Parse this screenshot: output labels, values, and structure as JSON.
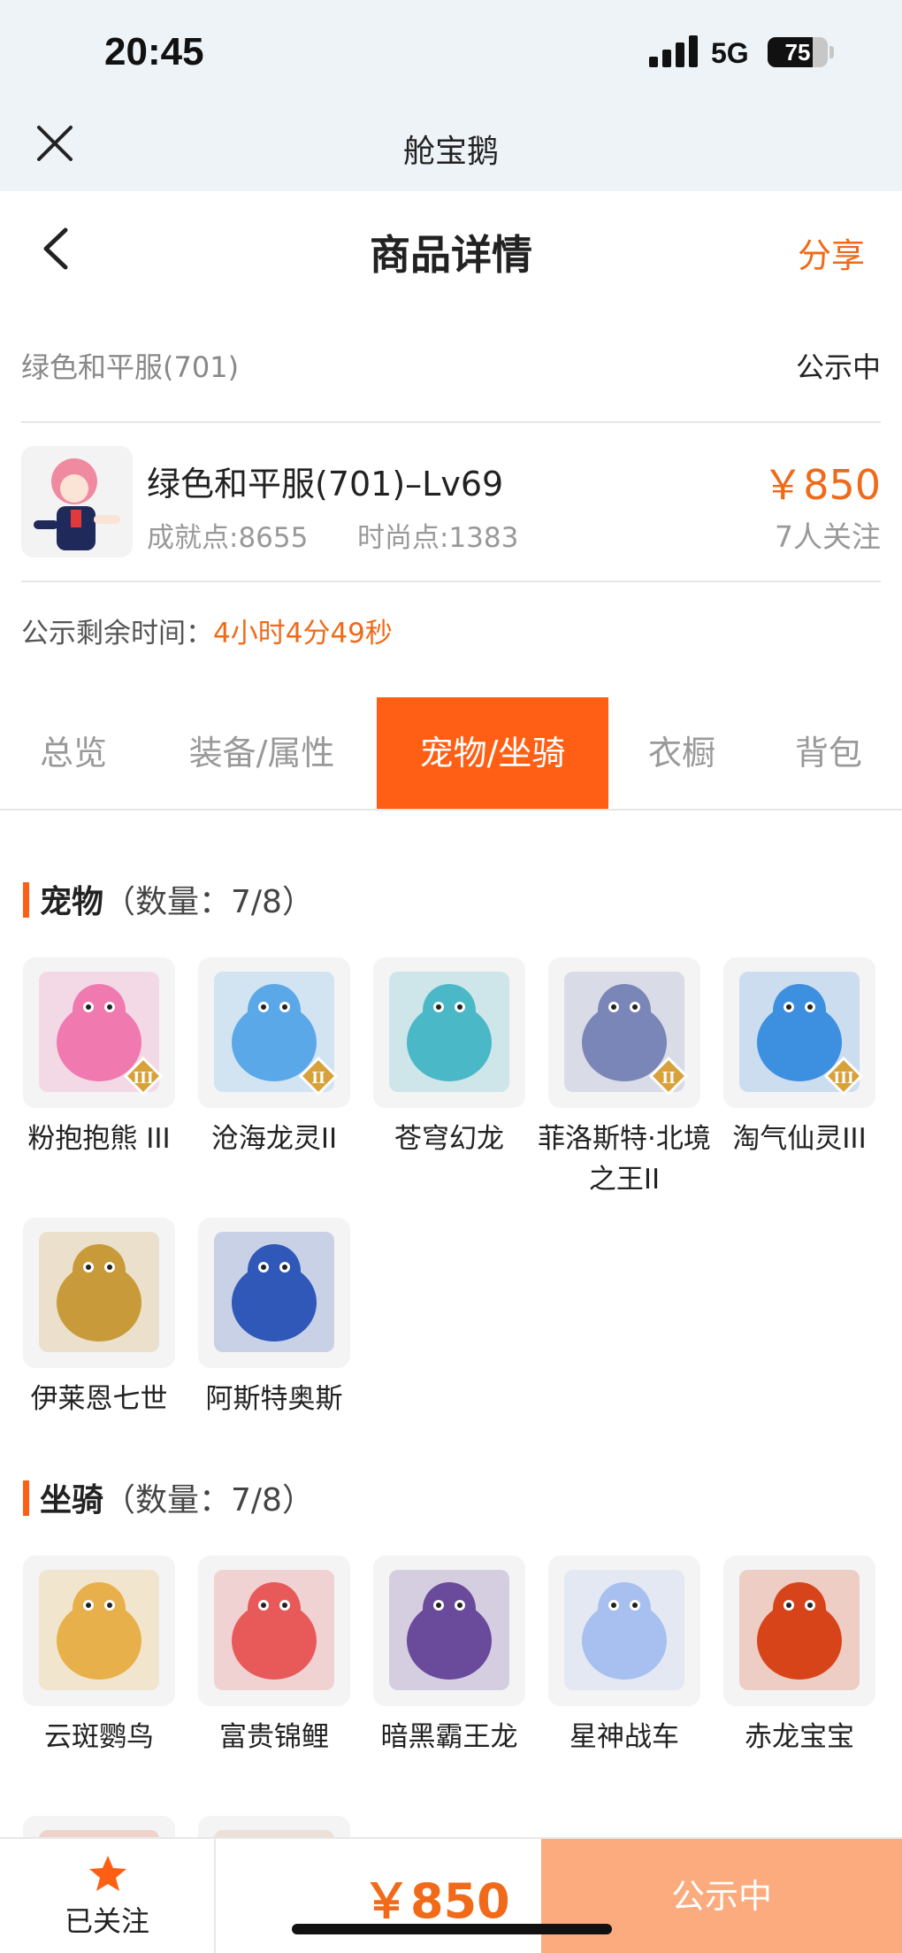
{
  "status": {
    "time": "20:45",
    "network": "5G",
    "battery": "75",
    "battery_level": 0.75
  },
  "app": {
    "title": "舱宝鹅"
  },
  "nav": {
    "title": "商品详情",
    "share": "分享"
  },
  "listing": {
    "name": "绿色和平服(701)",
    "state": "公示中"
  },
  "product": {
    "title": "绿色和平服(701)–Lv69",
    "achievement": "成就点:8655",
    "fashion": "时尚点:1383",
    "price": "￥850",
    "followers": "7人关注"
  },
  "countdown": {
    "label": "公示剩余时间：",
    "value": "4小时4分49秒"
  },
  "tabs": [
    {
      "label": "总览"
    },
    {
      "label": "装备/属性"
    },
    {
      "label": "宠物/坐骑"
    },
    {
      "label": "衣橱"
    },
    {
      "label": "背包"
    }
  ],
  "pets": {
    "title": "宠物",
    "count": "（数量：7/8）",
    "items": [
      {
        "name": "粉抱抱熊 III",
        "badge": "III",
        "color": "#f07ab0"
      },
      {
        "name": "沧海龙灵II",
        "badge": "II",
        "color": "#5aa8e8"
      },
      {
        "name": "苍穹幻龙",
        "badge": "",
        "color": "#4bb8c8"
      },
      {
        "name": "菲洛斯特·北境之王II",
        "badge": "II",
        "color": "#7a86b8"
      },
      {
        "name": "淘气仙灵III",
        "badge": "III",
        "color": "#3d8fe0"
      },
      {
        "name": "伊莱恩七世",
        "badge": "",
        "color": "#c89a3a"
      },
      {
        "name": "阿斯特奥斯",
        "badge": "",
        "color": "#2f58b8"
      }
    ]
  },
  "mounts": {
    "title": "坐骑",
    "count": "（数量：7/8）",
    "items": [
      {
        "name": "云斑鹦鸟",
        "color": "#e8b04a"
      },
      {
        "name": "富贵锦鲤",
        "color": "#e85a5a"
      },
      {
        "name": "暗黑霸王龙",
        "color": "#6a4a9a"
      },
      {
        "name": "星神战车",
        "color": "#a8c0f0"
      },
      {
        "name": "赤龙宝宝",
        "color": "#d8441a"
      },
      {
        "name": "",
        "color": "#e05a3a"
      },
      {
        "name": "",
        "color": "#d89a7a"
      }
    ]
  },
  "bottom": {
    "follow": "已关注",
    "price": "￥850",
    "cta": "公示中"
  },
  "colors": {
    "accent": "#ff5f15",
    "price": "#f06a1a",
    "cta": "#fbab7d"
  }
}
